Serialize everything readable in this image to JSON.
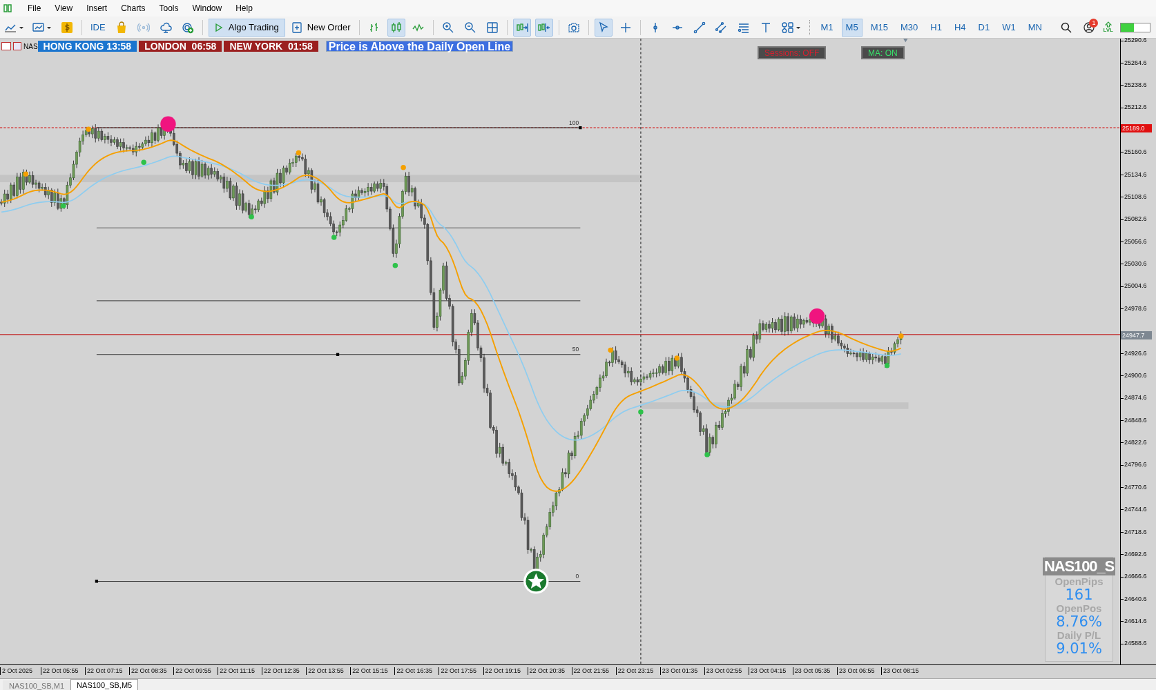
{
  "menu": [
    "File",
    "View",
    "Insert",
    "Charts",
    "Tools",
    "Window",
    "Help"
  ],
  "toolbar": {
    "ide": "IDE",
    "signals": {
      "disabled": true
    },
    "algo_trading": {
      "label": "Algo Trading",
      "selected": true
    },
    "new_order": "New Order",
    "chart_types": [
      {
        "selected": false
      },
      {
        "selected": true
      },
      {
        "selected": false
      }
    ],
    "autoscroll": {
      "selected": true
    },
    "chart_shift": {
      "selected": true
    },
    "cursor": {
      "selected": true
    },
    "timeframes": [
      {
        "label": "M1",
        "selected": false
      },
      {
        "label": "M5",
        "selected": true
      },
      {
        "label": "M15",
        "selected": false
      },
      {
        "label": "M30",
        "selected": false
      },
      {
        "label": "H1",
        "selected": false
      },
      {
        "label": "H4",
        "selected": false
      },
      {
        "label": "D1",
        "selected": false
      },
      {
        "label": "W1",
        "selected": false
      },
      {
        "label": "MN",
        "selected": false
      }
    ],
    "notification_badge": "1",
    "level_label": "LVL",
    "battery": {
      "level": 0.45
    }
  },
  "chart": {
    "symbol_cut": "NAS",
    "sessions": [
      {
        "label": "HONG KONG 13:58",
        "color": "#1b75cf"
      },
      {
        "label": "LONDON  06:58",
        "color": "#9b1f1f"
      },
      {
        "label": "NEW YORK  01:58",
        "color": "#9b1f1f"
      }
    ],
    "alert": "Price is Above the Daily Open Line",
    "toggles": [
      {
        "label": "Sessions: OFF",
        "on": false
      },
      {
        "label": "MA: ON",
        "on": true
      }
    ],
    "fib_levels": [
      {
        "label": "100"
      },
      {
        "label": "50"
      },
      {
        "label": "0"
      }
    ],
    "price_ticks": [
      "25290.6",
      "25264.6",
      "25238.6",
      "25212.6",
      "25160.6",
      "25134.6",
      "25108.6",
      "25082.6",
      "25056.6",
      "25030.6",
      "25004.6",
      "24978.6",
      "24926.6",
      "24900.6",
      "24874.6",
      "24848.6",
      "24822.6",
      "24796.6",
      "24770.6",
      "24744.6",
      "24718.6",
      "24692.6",
      "24666.6",
      "24640.6",
      "24614.6",
      "24588.6"
    ],
    "price_markers": [
      {
        "label": "25189.0",
        "kind": "high"
      },
      {
        "label": "24947.7",
        "kind": "bid"
      }
    ],
    "time_ticks": [
      "2 Oct 2025",
      "22 Oct 05:55",
      "22 Oct 07:15",
      "22 Oct 08:35",
      "22 Oct 09:55",
      "22 Oct 11:15",
      "22 Oct 12:35",
      "22 Oct 13:55",
      "22 Oct 15:15",
      "22 Oct 16:35",
      "22 Oct 17:55",
      "22 Oct 19:15",
      "22 Oct 20:35",
      "22 Oct 21:55",
      "22 Oct 23:15",
      "23 Oct 01:35",
      "23 Oct 02:55",
      "23 Oct 04:15",
      "23 Oct 05:35",
      "23 Oct 06:55",
      "23 Oct 08:15"
    ],
    "panel": {
      "symbol": "NAS100_S",
      "rows": [
        {
          "label": "OpenPips",
          "value": "161"
        },
        {
          "label": "OpenPos",
          "value": "8.76%"
        },
        {
          "label": "Daily P/L",
          "value": "9.01%"
        }
      ]
    }
  },
  "tabs": [
    {
      "label": "NAS100_SB,M1",
      "selected": false
    },
    {
      "label": "NAS100_SB,M5",
      "selected": true
    }
  ]
}
